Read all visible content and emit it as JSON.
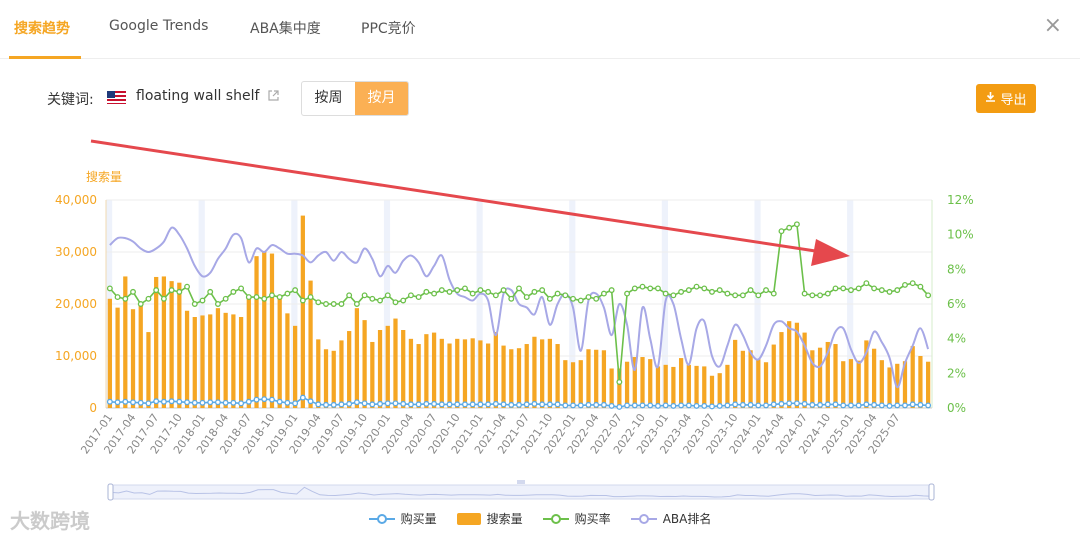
{
  "tabs": [
    {
      "label": "搜索趋势"
    },
    {
      "label": "Google Trends"
    },
    {
      "label": "ABA集中度"
    },
    {
      "label": "PPC竞价"
    }
  ],
  "close_icon": "×",
  "keyword": {
    "label": "关键词:",
    "flag": "us-flag-icon",
    "value": "floating wall shelf",
    "link_icon": "external-link-icon"
  },
  "period_toggle": {
    "week": "按周",
    "month": "按月",
    "selected": "month"
  },
  "export_label": "导出",
  "colors": {
    "search": "#f5a623",
    "buy": "#5aa9e6",
    "rate": "#6cc04a",
    "aba": "#a7a8e6",
    "accent": "#f39c12"
  },
  "watermark": "大数跨境",
  "legend": [
    {
      "key": "buy",
      "label": "购买量"
    },
    {
      "key": "search",
      "label": "搜索量"
    },
    {
      "key": "rate",
      "label": "购买率"
    },
    {
      "key": "aba",
      "label": "ABA排名"
    }
  ],
  "chart_data": {
    "type": "bar",
    "left_axis_label": "搜索量",
    "left_ticks": [
      "0",
      "10,000",
      "20,000",
      "30,000",
      "40,000"
    ],
    "right_ticks": [
      "0%",
      "2%",
      "4%",
      "6%",
      "8%",
      "10%",
      "12%"
    ],
    "ylim_left": [
      0,
      40000
    ],
    "ylim_right": [
      0,
      12
    ],
    "start_month": "2017-01",
    "x_tick_labels": [
      "2017-01",
      "2017-04",
      "2017-07",
      "2017-10",
      "2018-01",
      "2018-04",
      "2018-07",
      "2018-10",
      "2019-01",
      "2019-04",
      "2019-07",
      "2019-10",
      "2020-01",
      "2020-04",
      "2020-07",
      "2020-10",
      "2021-01",
      "2021-04",
      "2021-07",
      "2021-10",
      "2022-01",
      "2022-04",
      "2022-07",
      "2022-10",
      "2023-01",
      "2023-04",
      "2023-07",
      "2023-10",
      "2024-01",
      "2024-04",
      "2024-07",
      "2024-10",
      "2025-01",
      "2025-04",
      "2025-07"
    ],
    "series": [
      {
        "name": "搜索量",
        "type": "bar",
        "axis": "left",
        "values": [
          21000,
          19300,
          25300,
          19000,
          20000,
          14600,
          25200,
          25300,
          24400,
          24100,
          18700,
          17500,
          17800,
          18000,
          19200,
          18300,
          18000,
          17500,
          21000,
          29200,
          30000,
          29700,
          21000,
          18200,
          15800,
          37000,
          24500,
          13200,
          11300,
          11000,
          13000,
          14800,
          19200,
          16900,
          12700,
          15000,
          15800,
          17200,
          15000,
          13300,
          12300,
          14200,
          14500,
          13300,
          12400,
          13300,
          13200,
          13400,
          13000,
          12400,
          14600,
          12000,
          11300,
          11500,
          12300,
          13700,
          13200,
          13300,
          12300,
          9200,
          8800,
          9200,
          11300,
          11200,
          11100,
          7600,
          7600,
          8900,
          9800,
          9800,
          9400,
          8000,
          8300,
          7900,
          9600,
          8300,
          8100,
          8000,
          6200,
          6700,
          8300,
          13100,
          11000,
          11100,
          9400,
          8800,
          12200,
          14600,
          16700,
          16400,
          14500,
          11100,
          11600,
          12700,
          12300,
          9000,
          9400,
          9100,
          13000,
          11400,
          9200,
          7800,
          8500,
          9000,
          11900,
          10000,
          8900
        ]
      },
      {
        "name": "购买量",
        "type": "line",
        "axis": "left",
        "values": [
          1200,
          1100,
          1200,
          1100,
          1000,
          900,
          1300,
          1200,
          1300,
          1200,
          1100,
          1000,
          1000,
          1100,
          1100,
          1000,
          1000,
          900,
          1200,
          1600,
          1700,
          1600,
          1200,
          1000,
          900,
          2000,
          1300,
          700,
          600,
          600,
          700,
          800,
          1100,
          900,
          700,
          800,
          900,
          900,
          800,
          700,
          700,
          800,
          800,
          700,
          700,
          700,
          700,
          700,
          700,
          700,
          800,
          700,
          600,
          600,
          700,
          800,
          700,
          700,
          700,
          500,
          500,
          500,
          600,
          600,
          600,
          400,
          200,
          500,
          500,
          500,
          500,
          400,
          500,
          400,
          500,
          500,
          400,
          400,
          300,
          400,
          500,
          700,
          600,
          600,
          500,
          500,
          700,
          800,
          900,
          900,
          800,
          600,
          600,
          700,
          700,
          500,
          500,
          500,
          700,
          600,
          500,
          400,
          500,
          500,
          700,
          600,
          500
        ]
      },
      {
        "name": "购买率",
        "type": "line",
        "axis": "right",
        "unit": "%",
        "values": [
          6.9,
          6.4,
          6.3,
          6.7,
          6.0,
          6.3,
          6.8,
          6.3,
          6.8,
          6.7,
          7.0,
          6.0,
          6.2,
          6.7,
          6.0,
          6.3,
          6.7,
          6.9,
          6.4,
          6.4,
          6.3,
          6.5,
          6.4,
          6.6,
          6.8,
          6.2,
          6.4,
          6.1,
          6.0,
          6.0,
          6.0,
          6.5,
          6.0,
          6.5,
          6.3,
          6.2,
          6.5,
          6.1,
          6.2,
          6.5,
          6.4,
          6.7,
          6.6,
          6.8,
          6.7,
          6.8,
          6.9,
          6.6,
          6.8,
          6.7,
          6.5,
          6.8,
          6.3,
          6.9,
          6.4,
          6.7,
          6.8,
          6.3,
          6.6,
          6.5,
          6.3,
          6.2,
          6.4,
          6.3,
          6.6,
          6.8,
          1.5,
          6.6,
          6.9,
          7.0,
          6.9,
          6.9,
          6.6,
          6.5,
          6.7,
          6.8,
          7.0,
          6.9,
          6.7,
          6.8,
          6.6,
          6.5,
          6.5,
          6.8,
          6.5,
          6.8,
          6.6,
          10.2,
          10.4,
          10.6,
          6.6,
          6.5,
          6.5,
          6.6,
          6.9,
          6.9,
          6.8,
          6.9,
          7.2,
          6.9,
          6.8,
          6.7,
          6.8,
          7.1,
          7.2,
          7.0,
          6.5
        ]
      },
      {
        "name": "ABA排名",
        "type": "line",
        "axis": "right",
        "note": "line without axis values",
        "values": [
          9.4,
          9.8,
          9.8,
          9.6,
          9.2,
          9.0,
          9.2,
          9.6,
          10.4,
          10.0,
          9.2,
          8.2,
          7.6,
          7.8,
          8.6,
          9.2,
          10.0,
          9.8,
          8.4,
          9.2,
          9.0,
          9.4,
          9.2,
          8.9,
          8.9,
          8.8,
          8.4,
          8.8,
          9.0,
          8.5,
          9.0,
          8.6,
          8.4,
          9.2,
          8.6,
          7.6,
          8.2,
          7.8,
          8.5,
          8.8,
          8.4,
          7.6,
          8.2,
          8.8,
          7.4,
          6.6,
          6.4,
          6.2,
          6.6,
          6.2,
          4.2,
          6.6,
          6.8,
          6.0,
          5.8,
          5.4,
          6.4,
          4.8,
          6.0,
          6.6,
          5.8,
          3.3,
          6.2,
          6.6,
          5.8,
          4.2,
          6.0,
          4.8,
          2.2,
          5.8,
          4.0,
          2.4,
          6.2,
          6.0,
          4.0,
          2.5,
          4.6,
          5.0,
          3.0,
          2.4,
          3.6,
          4.8,
          4.2,
          3.2,
          2.8,
          3.6,
          4.8,
          5.0,
          4.6,
          4.4,
          3.6,
          2.6,
          2.4,
          3.2,
          4.4,
          4.6,
          3.4,
          2.6,
          3.2,
          4.4,
          3.8,
          2.9,
          1.2,
          2.6,
          3.6,
          4.6,
          3.4
        ]
      }
    ]
  }
}
